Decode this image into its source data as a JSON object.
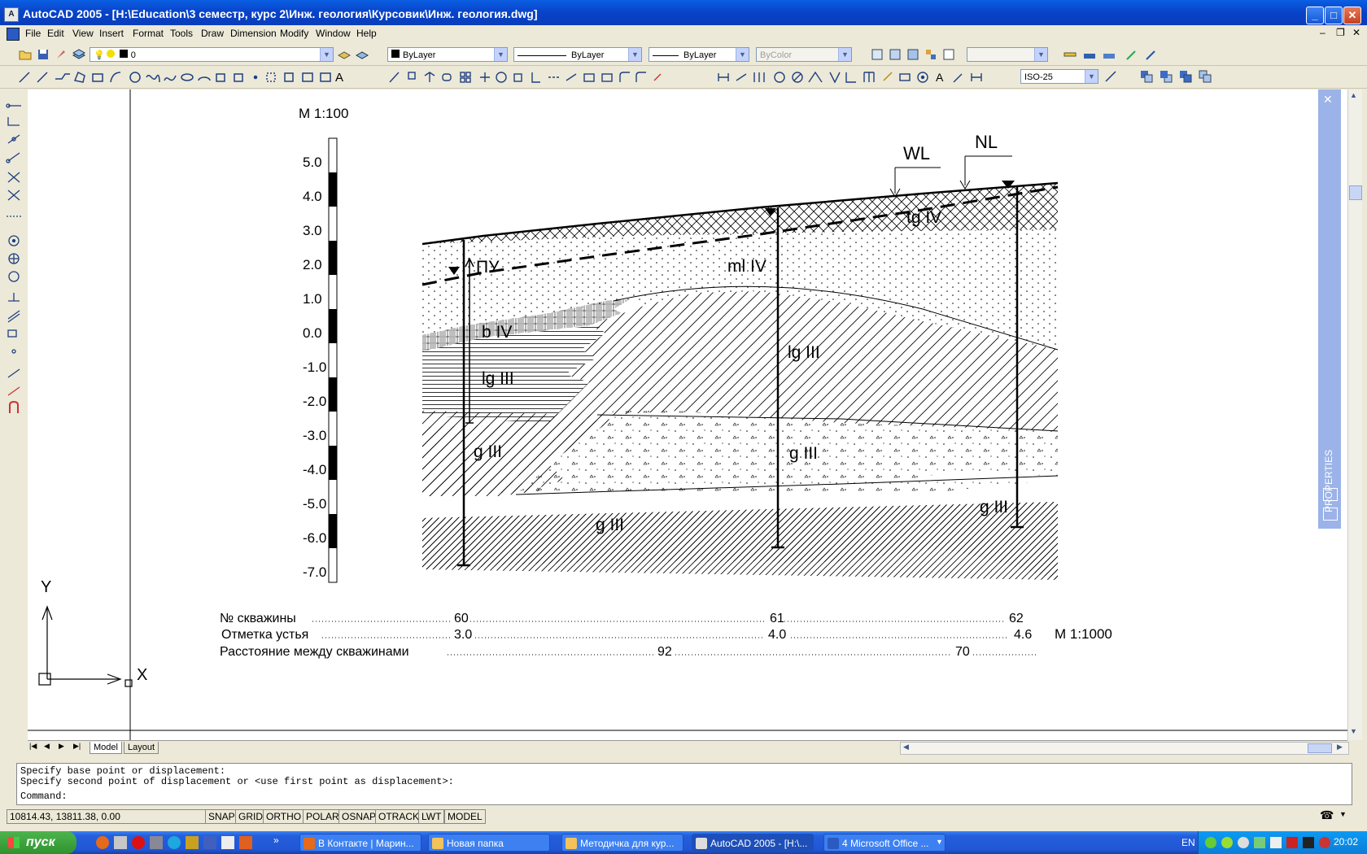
{
  "window": {
    "title": "AutoCAD 2005 - [H:\\Education\\3 семестр, курс 2\\Инж. геология\\Курсовик\\Инж. геология.dwg]",
    "minimize": "_",
    "maximize": "□",
    "close": "✕"
  },
  "menu": [
    "File",
    "Edit",
    "View",
    "Insert",
    "Format",
    "Tools",
    "Draw",
    "Dimension",
    "Modify",
    "Window",
    "Help"
  ],
  "toolbar": {
    "layer_value": "0",
    "color_value": "ByLayer",
    "linetype_value": "ByLayer",
    "lineweight_value": "ByLayer",
    "plotstyle_value": "ByColor",
    "dimstyle_value": "ISO-25"
  },
  "drawing": {
    "scale_vertical": "M 1:100",
    "scale_horizontal": "M 1:1000",
    "scale_ticks": [
      "5.0",
      "4.0",
      "3.0",
      "2.0",
      "1.0",
      "0.0",
      "-1.0",
      "-2.0",
      "-3.0",
      "-4.0",
      "-5.0",
      "-6.0",
      "-7.0"
    ],
    "labels": {
      "wl": "WL",
      "nl": "NL",
      "tg": "tg IV",
      "ml": "ml IV",
      "pu": "ПУ",
      "b": "b IV",
      "lg1": "lg III",
      "lg2": "lg III",
      "g1": "g III",
      "g2": "g III",
      "g3": "g III",
      "g4": "g III"
    },
    "rows": {
      "wells_label": "№ скважины",
      "wells": [
        "60",
        "61",
        "62"
      ],
      "elev_label": "Отметка устья",
      "elevs": [
        "3.0",
        "4.0",
        "4.6"
      ],
      "dist_label": "Расстояние между скважинами",
      "dists": [
        "92",
        "70"
      ]
    },
    "ucs_x": "X",
    "ucs_y": "Y"
  },
  "properties_palette": "PROPERTIES",
  "tabs": [
    "Model",
    "Layout"
  ],
  "command": {
    "line1": "Specify base point or displacement:",
    "line2": "Specify second point of displacement or <use first point as displacement>:",
    "prompt": "Command:"
  },
  "status": {
    "coords": "10814.43, 13811.38, 0.00",
    "buttons": [
      "SNAP",
      "GRID",
      "ORTHO",
      "POLAR",
      "OSNAP",
      "OTRACK",
      "LWT",
      "MODEL"
    ]
  },
  "taskbar": {
    "start": "пуск",
    "tasks": [
      "В Контакте | Марин...",
      "Новая папка",
      "Методичка для кур...",
      "AutoCAD 2005 - [H:\\...",
      "4 Microsoft Office ..."
    ],
    "lang": "EN",
    "clock": "20:02"
  }
}
